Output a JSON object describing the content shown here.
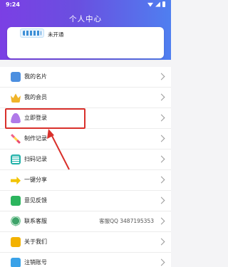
{
  "status_bar": {
    "time": "9:24"
  },
  "header": {
    "title": "个人中心"
  },
  "member_card": {
    "status": "未开通"
  },
  "menu": {
    "items": [
      {
        "label": "我的名片",
        "extra": ""
      },
      {
        "label": "我的会员",
        "extra": ""
      },
      {
        "label": "立即登录",
        "extra": ""
      },
      {
        "label": "制作记录",
        "extra": ""
      },
      {
        "label": "扫码记录",
        "extra": ""
      },
      {
        "label": "一键分享",
        "extra": ""
      },
      {
        "label": "意见反馈",
        "extra": ""
      },
      {
        "label": "联系客服",
        "extra": "客服QQ 3487195353"
      },
      {
        "label": "关于我们",
        "extra": ""
      },
      {
        "label": "注销账号",
        "extra": ""
      }
    ]
  },
  "colors": {
    "header_start": "#7b3fe4",
    "header_end": "#4f7ff0",
    "highlight": "#d9302b"
  },
  "icons": [
    "card-icon",
    "crown-icon",
    "user-icon",
    "pencil-icon",
    "scan-icon",
    "share-icon",
    "feedback-icon",
    "service-icon",
    "about-icon",
    "cancel-icon"
  ]
}
